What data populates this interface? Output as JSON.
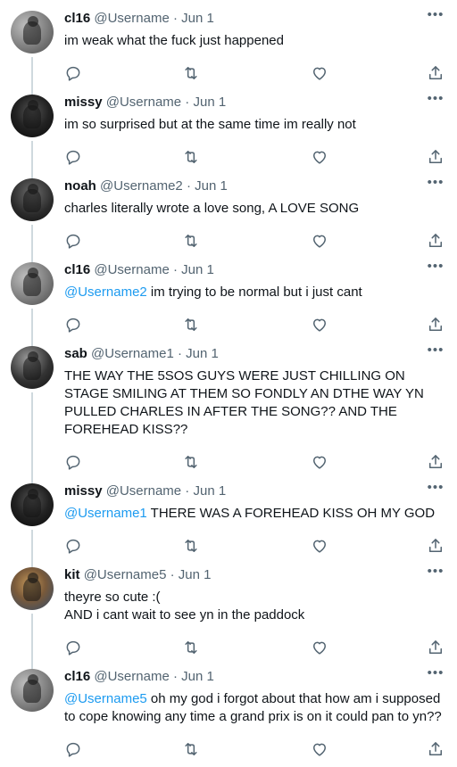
{
  "more_glyph": "•••",
  "icons": [
    "reply-icon",
    "retweet-icon",
    "like-icon",
    "share-icon"
  ],
  "colors": {
    "text": "#0f1419",
    "muted": "#536471",
    "link": "#1d9bf0",
    "thread_line": "#cfd9de"
  },
  "tweets": [
    {
      "name": "cl16",
      "handle": "@Username",
      "date": "Jun 1",
      "parts": [
        {
          "t": "im weak what the fuck just happened"
        }
      ]
    },
    {
      "name": "missy",
      "handle": "@Username",
      "date": "Jun 1",
      "parts": [
        {
          "t": "im so surprised but at the same time im really not"
        }
      ]
    },
    {
      "name": "noah",
      "handle": "@Username2",
      "date": "Jun 1",
      "parts": [
        {
          "t": "charles literally wrote a love song, A LOVE SONG"
        }
      ]
    },
    {
      "name": "cl16",
      "handle": "@Username",
      "date": "Jun 1",
      "parts": [
        {
          "m": "@Username2"
        },
        {
          "t": " im trying to be normal but i just cant"
        }
      ]
    },
    {
      "name": "sab",
      "handle": "@Username1",
      "date": "Jun 1",
      "parts": [
        {
          "t": "THE WAY THE 5SOS GUYS WERE JUST CHILLING ON STAGE SMILING AT THEM SO FONDLY AN DTHE WAY YN PULLED CHARLES IN AFTER THE SONG?? AND THE FOREHEAD KISS??"
        }
      ]
    },
    {
      "name": "missy",
      "handle": "@Username",
      "date": "Jun 1",
      "parts": [
        {
          "m": "@Username1"
        },
        {
          "t": " THERE WAS A FOREHEAD KISS OH MY GOD"
        }
      ]
    },
    {
      "name": "kit",
      "handle": "@Username5",
      "date": "Jun 1",
      "parts": [
        {
          "t": "theyre so cute :("
        },
        {
          "br": true
        },
        {
          "t": "AND i cant wait to see yn in the paddock"
        }
      ]
    },
    {
      "name": "cl16",
      "handle": "@Username",
      "date": "Jun 1",
      "parts": [
        {
          "m": "@Username5"
        },
        {
          "t": " oh my god i forgot about that how am i supposed to cope knowing any time a grand prix is on it could pan to yn??"
        }
      ]
    }
  ]
}
